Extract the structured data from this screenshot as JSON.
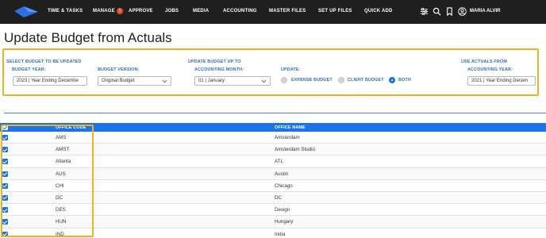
{
  "nav": {
    "items": [
      "TIME & TASKS",
      "MANAGE",
      "APPROVE",
      "JOBS",
      "MEDIA",
      "ACCOUNTING",
      "MASTER FILES",
      "SET UP FILES",
      "QUICK ADD"
    ],
    "manage_badge": "!",
    "user_name": "MARIA ALVIR"
  },
  "page": {
    "title": "Update Budget from Actuals"
  },
  "filters": {
    "select_budget_heading": "SELECT BUDGET TO BE UPDATED",
    "budget_year_label": "BUDGET YEAR:",
    "budget_year_value": "2023 | Year Ending Decembe",
    "budget_version_label": "BUDGET VERSION:",
    "budget_version_value": "Original Budget",
    "update_up_to_heading": "UPDATE BUDGET UP TO",
    "accounting_month_label": "ACCOUNTING MONTH:",
    "accounting_month_value": "01 | January",
    "update_label": "UPDATE:",
    "radio_expense": "EXPENSE BUDGET",
    "radio_client": "CLIENT BUDGET",
    "radio_both": "BOTH",
    "selected_update": "BOTH",
    "use_actuals_heading": "USE ACTUALS FROM",
    "accounting_year_label": "ACCOUNTING YEAR:",
    "accounting_year_value": "2021 | Year Ending Decem"
  },
  "table": {
    "columns": [
      "OFFICE CODE",
      "OFFICE NAME"
    ],
    "rows": [
      {
        "code": "AMS",
        "name": "Amsterdam"
      },
      {
        "code": "AMST",
        "name": "Amsterdam Studio"
      },
      {
        "code": "Atlanta",
        "name": "ATL"
      },
      {
        "code": "AUS",
        "name": "Austin"
      },
      {
        "code": "CHI",
        "name": "Chicago"
      },
      {
        "code": "DC",
        "name": "DC"
      },
      {
        "code": "DES",
        "name": "Design"
      },
      {
        "code": "HUN",
        "name": "Hungary"
      },
      {
        "code": "IND",
        "name": "India"
      }
    ]
  },
  "colors": {
    "topbar": "#1f1f1f",
    "accent": "#1a73e8",
    "label_blue": "#2a6fbd",
    "highlight": "#f2b01e"
  }
}
